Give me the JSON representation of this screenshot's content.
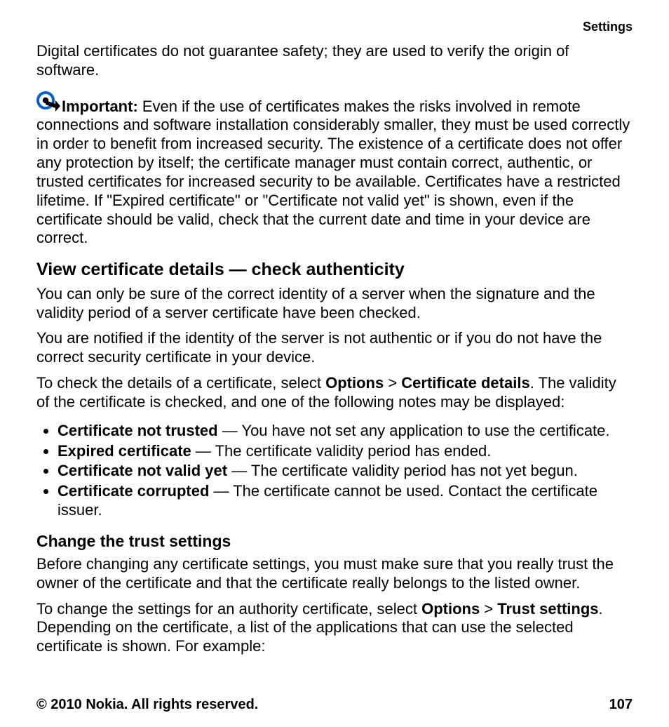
{
  "header": {
    "section": "Settings"
  },
  "intro": "Digital certificates do not guarantee safety; they are used to verify the origin of software.",
  "important": {
    "label": "Important:",
    "text": " Even if the use of certificates makes the risks involved in remote connections and software installation considerably smaller, they must be used correctly in order to benefit from increased security. The existence of a certificate does not offer any protection by itself; the certificate manager must contain correct, authentic, or trusted certificates for increased security to be available. Certificates have a restricted lifetime. If \"Expired certificate\" or \"Certificate not valid yet\" is shown, even if the certificate should be valid, check that the current date and time in your device are correct."
  },
  "section1": {
    "title": "View certificate details — check authenticity",
    "p1": "You can only be sure of the correct identity of a server when the signature and the validity period of a server certificate have been checked.",
    "p2": "You are notified if the identity of the server is not authentic or if you do not have the correct security certificate in your device.",
    "p3_pre": "To check the details of a certificate, select ",
    "p3_b1": "Options",
    "p3_gt": " > ",
    "p3_b2": "Certificate details",
    "p3_post": ". The validity of the certificate is checked, and one of the following notes may be displayed:",
    "bullets": [
      {
        "title": "Certificate not trusted",
        "text": "  — You have not set any application to use the certificate."
      },
      {
        "title": "Expired certificate",
        "text": "  — The certificate validity period has ended."
      },
      {
        "title": "Certificate not valid yet",
        "text": "  — The certificate validity period has not yet begun."
      },
      {
        "title": "Certificate corrupted",
        "text": "  — The certificate cannot be used. Contact the certificate issuer."
      }
    ]
  },
  "section2": {
    "title": "Change the trust settings",
    "p1": "Before changing any certificate settings, you must make sure that you really trust the owner of the certificate and that the certificate really belongs to the listed owner.",
    "p2_pre": "To change the settings for an authority certificate, select ",
    "p2_b1": "Options",
    "p2_gt": " > ",
    "p2_b2": "Trust settings",
    "p2_post": ". Depending on the certificate, a list of the applications that can use the selected certificate is shown. For example:"
  },
  "footer": {
    "copyright": "© 2010 Nokia. All rights reserved.",
    "page": "107"
  }
}
